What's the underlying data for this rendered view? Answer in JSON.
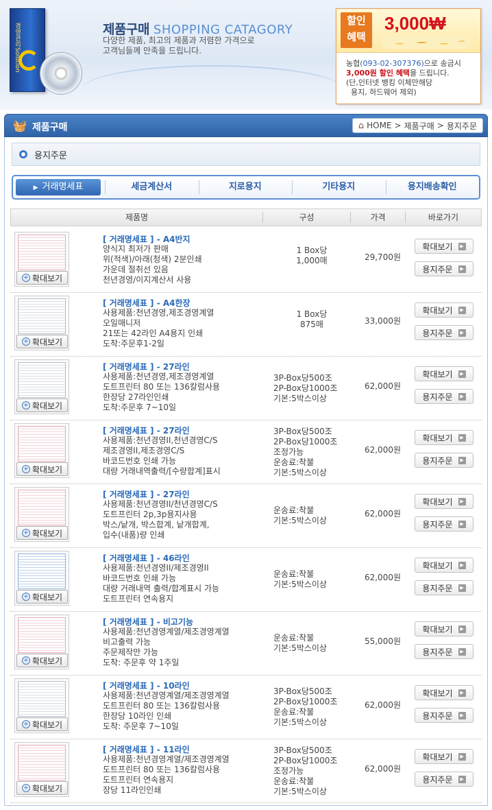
{
  "banner": {
    "title_ko": "제품구매",
    "title_en": "SHOPPING CATAGORY",
    "subtitle_line1": "다양한 제품, 최고의 제품과 저렴한 가격으로",
    "subtitle_line2": "고객님들께 만족을 드립니다.",
    "box_text": "경영관리Solution",
    "promo": {
      "tag_line1": "할인",
      "tag_line2": "혜택",
      "amount": "3,000₩",
      "bank": "농협",
      "account": "(093-02-307376)",
      "line1_rest": "으로 송금시",
      "discount": "3,000원 할인 혜택",
      "line2_rest": "을 드립니다.",
      "note1": "(단,인터넷 뱅킹 이체만해당",
      "note2": "용지, 하드웨어 제외)"
    }
  },
  "section": {
    "title": "제품구매",
    "breadcrumb": [
      "HOME",
      ">",
      "제품구매",
      ">",
      "용지주문"
    ],
    "subheading": "용지주문"
  },
  "tabs": [
    "거래명세표",
    "세금계산서",
    "지로용지",
    "기타용지",
    "용지배송확인"
  ],
  "table": {
    "headers": [
      "제품명",
      "구성",
      "가격",
      "바로가기"
    ],
    "zoom_label": "확대보기",
    "order_label": "용지주문",
    "rows": [
      {
        "name": "[ 거래명세표 ] - A4반지",
        "desc": [
          "양식지 최저가 판매",
          "위(적색)/아래(청색) 2분인쇄",
          "가운데 절취선 있음",
          "천년경영/이지계산서 사용"
        ],
        "comp": [
          "1 Box당",
          "1,000매"
        ],
        "price": "29,700원"
      },
      {
        "name": "[ 거래명세표 ] - A4한장",
        "desc": [
          "사용제품:천년경영,제조경영계열",
          "오일매니저",
          "21또는 42라인 A4용지 인쇄",
          "도착:주문후1-2일"
        ],
        "comp": [
          "1 Box당",
          "875매"
        ],
        "price": "33,000원"
      },
      {
        "name": "[ 거래명세표 ] - 27라인",
        "desc": [
          "사용제품:천년경영,제조경영계열",
          "도트프린터 80 또는 136칼럼사용",
          "한장당 27라인인쇄",
          "도착:주문후 7~10일"
        ],
        "comp": [
          "3P-Box당500조",
          "2P-Box당1000조",
          "기본:5박스이상"
        ],
        "price": "62,000원"
      },
      {
        "name": "[ 거래명세표 ] - 27라인",
        "desc": [
          "사용제품:천년경영II,천년경영C/S",
          "제조경영II,제조경영C/S",
          "바코드번호 인쇄 가능",
          "대량 거래내역출력/[수량합계]표시"
        ],
        "comp": [
          "3P-Box당500조",
          "2P-Box당1000조",
          "조정가능",
          "운송료:착불",
          "기본:5박스이상"
        ],
        "price": "62,000원"
      },
      {
        "name": "[ 거래명세표 ] - 27라인",
        "desc": [
          "사용제품:천년경영II/천년경영C/S",
          "도트프린터 2p,3p용지사용",
          "박스/낱개, 박스합계, 낱개합계,",
          "입수(내품)량 인쇄"
        ],
        "comp": [
          "운송료:착불",
          "기본:5박스이상"
        ],
        "price": "62,000원"
      },
      {
        "name": "[ 거래명세표 ] - 46라인",
        "desc": [
          "사용제품:천년경영II/제조경영II",
          "바코드번호 인쇄 가능",
          "대량 거래내역 출력/합계표시 가능",
          "도트프린터 연속용지"
        ],
        "comp": [
          "운송료:착불",
          "기본:5박스이상"
        ],
        "price": "62,000원"
      },
      {
        "name": "[ 거래명세표 ] - 비고기능",
        "desc": [
          "사용제품:천년경영계열/제조경영계열",
          "비고출력 가능",
          "주문제작만 가능",
          "도착: 주문후 약 1주일"
        ],
        "comp": [
          "운송료:착불",
          "기본:5박스이상"
        ],
        "price": "55,000원"
      },
      {
        "name": "[ 거래명세표 ] - 10라인",
        "desc": [
          "사용제품:천년경영계열/제조경영계열",
          "도트프린터 80 또는 136칼럼사용",
          "한장당 10라인 인쇄",
          "도착: 주문후 7~10일"
        ],
        "comp": [
          "3P-Box당500조",
          "2P-Box당1000조",
          "운송료:착불",
          "기본:5박스이상"
        ],
        "price": "62,000원"
      },
      {
        "name": "[ 거래명세표 ] - 11라인",
        "desc": [
          "사용제품:천년경영계열/제조경영계열",
          "도트프린터 80 또는 136칼럼사용",
          "도트프린터 연속용지",
          "장당 11라인인쇄"
        ],
        "comp": [
          "3P-Box당500조",
          "2P-Box당1000조",
          "조정가능",
          "운송료:착불",
          "기본:5박스이상"
        ],
        "price": "62,000원"
      }
    ]
  },
  "colors": {
    "accent": "#2f63a8",
    "link": "#2a6ab8",
    "promo_red": "#d3121a"
  }
}
